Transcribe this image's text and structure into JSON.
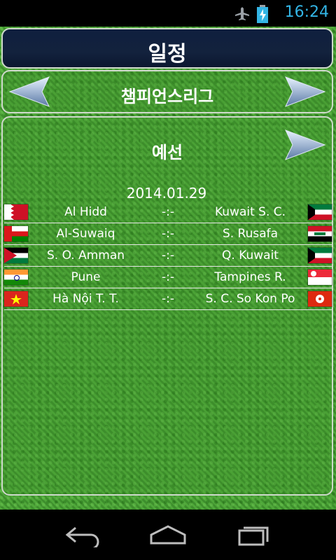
{
  "status": {
    "time": "16:24",
    "icons": [
      "airplane-mode-icon",
      "battery-charging-icon"
    ]
  },
  "header": {
    "title": "일정"
  },
  "league": {
    "name": "챔피언스리그"
  },
  "stage": {
    "name": "예선"
  },
  "date": "2014.01.29",
  "matches": [
    {
      "home": "Al Hidd",
      "score": "-:-",
      "away": "Kuwait S. C.",
      "home_flag": "bahrain-flag-icon",
      "away_flag": "kuwait-flag-icon"
    },
    {
      "home": "Al-Suwaiq",
      "score": "-:-",
      "away": "S. Rusafa",
      "home_flag": "oman-flag-icon",
      "away_flag": "iraq-flag-icon"
    },
    {
      "home": "S. O. Amman",
      "score": "-:-",
      "away": "Q. Kuwait",
      "home_flag": "jordan-flag-icon",
      "away_flag": "kuwait-flag-icon"
    },
    {
      "home": "Pune",
      "score": "-:-",
      "away": "Tampines R.",
      "home_flag": "india-flag-icon",
      "away_flag": "singapore-flag-icon"
    },
    {
      "home": "Hà Nội T. T.",
      "score": "-:-",
      "away": "S. C. So Kon Po",
      "home_flag": "vietnam-flag-icon",
      "away_flag": "hong-kong-flag-icon"
    }
  ],
  "colors": {
    "status_accent": "#33b5e5",
    "title_bar": "#13223d",
    "grass": "#3f9a2f"
  },
  "navigation": [
    "back-icon",
    "home-icon",
    "recent-apps-icon"
  ]
}
